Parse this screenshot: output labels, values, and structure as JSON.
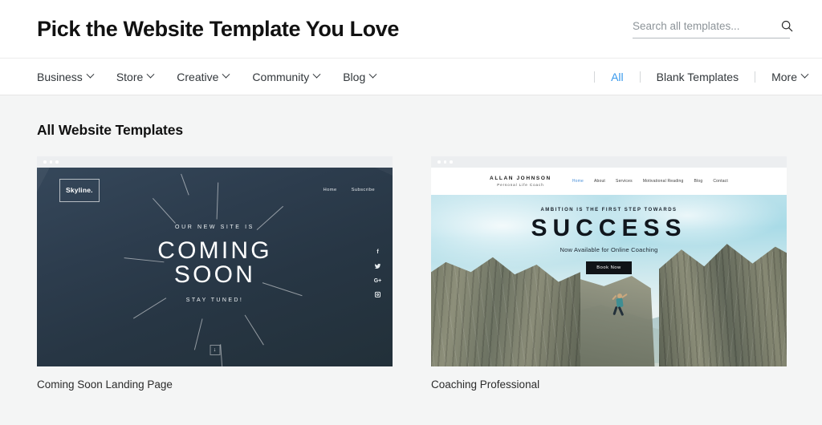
{
  "header": {
    "title": "Pick the Website Template You Love",
    "search": {
      "placeholder": "Search all templates...",
      "value": "",
      "icon": "search-icon"
    }
  },
  "nav": {
    "left": [
      {
        "label": "Business",
        "caret": true
      },
      {
        "label": "Store",
        "caret": true
      },
      {
        "label": "Creative",
        "caret": true
      },
      {
        "label": "Community",
        "caret": true
      },
      {
        "label": "Blog",
        "caret": true
      }
    ],
    "right": [
      {
        "label": "All",
        "caret": false,
        "active": true
      },
      {
        "label": "Blank Templates",
        "caret": false,
        "active": false
      },
      {
        "label": "More",
        "caret": true,
        "active": false
      }
    ],
    "active_color": "#3899ec"
  },
  "main": {
    "section_title": "All Website Templates",
    "cards": [
      {
        "caption": "Coming Soon Landing Page",
        "preview": {
          "logo": "Skyline.",
          "nav": [
            "Home",
            "Subscribe"
          ],
          "kicker": "OUR NEW SITE IS",
          "headline_line1": "COMING",
          "headline_line2": "SOON",
          "tagline": "STAY TUNED!",
          "social": [
            "facebook-icon",
            "twitter-icon",
            "google-plus-icon",
            "instagram-icon"
          ],
          "social_glyphs": [
            "f",
            "🐦",
            "G+",
            ""
          ],
          "scroll_indicator": "↓"
        }
      },
      {
        "caption": "Coaching Professional",
        "preview": {
          "brand_name": "ALLAN JOHNSON",
          "brand_sub": "Personal Life Coach",
          "nav": [
            "Home",
            "About",
            "Services",
            "Motivational Reading",
            "Blog",
            "Contact"
          ],
          "nav_active": "Home",
          "kicker": "AMBITION IS THE FIRST STEP TOWARDS",
          "headline": "SUCCESS",
          "subline": "Now Available for Online Coaching",
          "button": "Book Now"
        }
      }
    ]
  },
  "theme": {
    "page_bg": "#f4f5f5",
    "surface": "#ffffff",
    "text": "#2b2b2b",
    "accent": "#3899ec"
  }
}
